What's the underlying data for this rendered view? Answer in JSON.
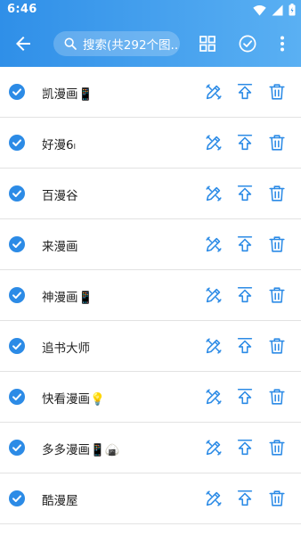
{
  "status_bar": {
    "time": "6:46"
  },
  "toolbar": {
    "search_placeholder": "搜索(共292个图..."
  },
  "items": [
    {
      "name": "凯漫画📱",
      "checked": true
    },
    {
      "name": "好漫6ₗ",
      "checked": true
    },
    {
      "name": "百漫谷",
      "checked": true
    },
    {
      "name": "来漫画",
      "checked": true
    },
    {
      "name": "神漫画📱",
      "checked": true
    },
    {
      "name": "追书大师",
      "checked": true
    },
    {
      "name": "快看漫画💡",
      "checked": true
    },
    {
      "name": "多多漫画📱🍙",
      "checked": true
    },
    {
      "name": "酷漫屋",
      "checked": true
    }
  ],
  "colors": {
    "appbar_start": "#2f8fe8",
    "appbar_end": "#5ab0f3",
    "accent": "#2c8be6",
    "divider": "#e2e2e2"
  },
  "icons": {
    "row_actions": [
      "edit-pencil-icon",
      "move-to-top-icon",
      "delete-trash-icon"
    ],
    "toolbar": [
      "back-arrow-icon",
      "search-icon",
      "grid-view-icon",
      "select-all-check-icon",
      "more-vert-icon"
    ]
  }
}
